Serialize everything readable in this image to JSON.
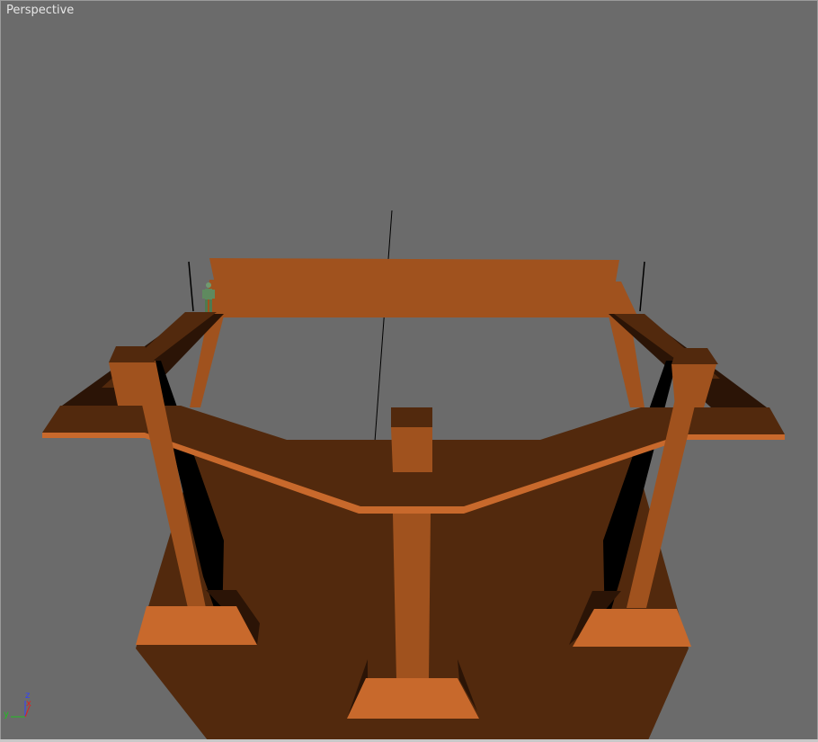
{
  "viewport": {
    "label": "Perspective",
    "active": true
  },
  "axis_gizmo": {
    "z_label": "z",
    "x_label": "x",
    "y_label": "y"
  },
  "colors": {
    "background": "#6b6b6b",
    "wood_light": "#c8692c",
    "wood_mid": "#a0521e",
    "wood_dark": "#52290d",
    "wood_shadow": "#2b1406",
    "axis_x": "#e02020",
    "axis_y": "#20c020",
    "axis_z": "#3040ff"
  },
  "icons": {
    "character": "human-figure-icon"
  }
}
